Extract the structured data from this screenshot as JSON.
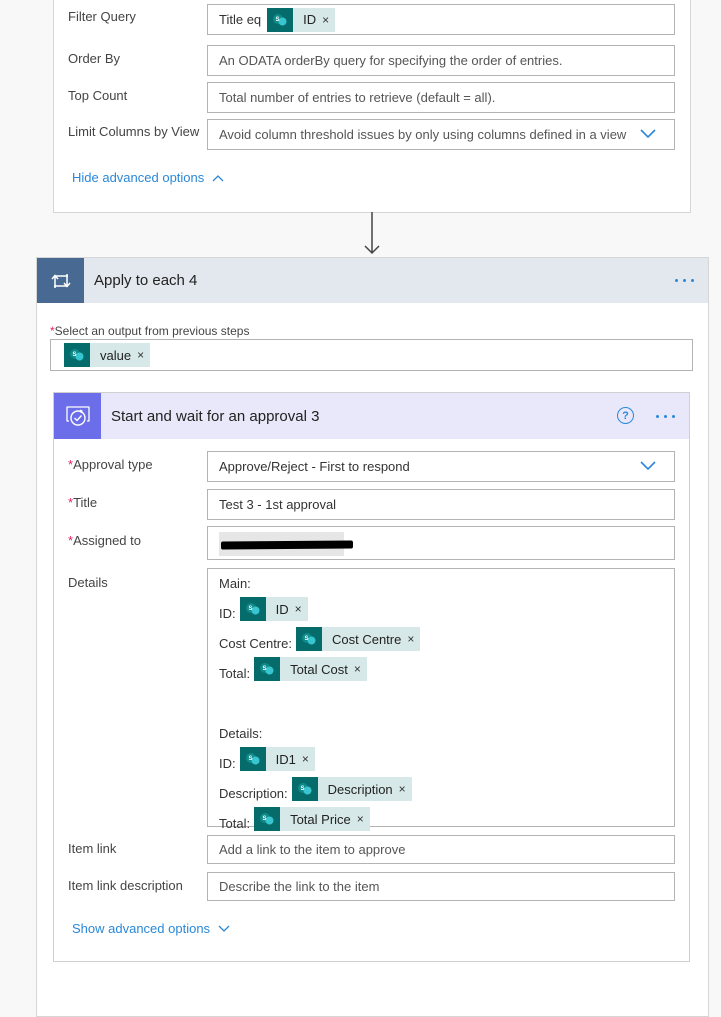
{
  "get_items_card": {
    "fields": [
      {
        "label": "Filter Query",
        "prefix_text": "Title eq",
        "token": {
          "icon": "sharepoint-icon",
          "label": "ID",
          "remove": "×"
        }
      },
      {
        "label": "Order By",
        "placeholder": "An ODATA orderBy query for specifying the order of entries."
      },
      {
        "label": "Top Count",
        "placeholder": "Total number of entries to retrieve (default = all)."
      },
      {
        "label": "Limit Columns by View",
        "placeholder": "Avoid column threshold issues by only using columns defined in a view",
        "dropdown_icon": "chevron-down-icon"
      }
    ],
    "advanced_link": "Hide advanced options"
  },
  "apply_to_each": {
    "title": "Apply to each 4",
    "icon": "loop-icon",
    "menu_icon": "more-options-icon",
    "required_marker": "*",
    "select_label": "Select an output from previous steps",
    "select_token": {
      "icon": "sharepoint-icon",
      "label": "value",
      "remove": "×"
    }
  },
  "approval": {
    "title": "Start and wait for an approval 3",
    "icon": "approval-icon",
    "help_glyph": "?",
    "required_marker": "*",
    "approval_type": {
      "label": "Approval type",
      "value": "Approve/Reject - First to respond"
    },
    "title_field": {
      "label": "Title",
      "value": "Test 3 - 1st approval"
    },
    "assigned_to": {
      "label": "Assigned to",
      "value": "[redacted]"
    },
    "details": {
      "label": "Details",
      "lines": [
        {
          "text": "Main:"
        },
        {
          "text": "ID:",
          "token": "ID"
        },
        {
          "text": "Cost Centre:",
          "token": "Cost Centre"
        },
        {
          "text": "Total:",
          "token": "Total Cost"
        },
        {
          "text": ""
        },
        {
          "text": "Details:"
        },
        {
          "text": "ID:",
          "token": "ID1"
        },
        {
          "text": "Description:",
          "token": "Description"
        },
        {
          "text": "Total:",
          "token": "Total Price"
        }
      ],
      "remove_glyph": "×"
    },
    "item_link": {
      "label": "Item link",
      "placeholder": "Add a link to the item to approve"
    },
    "item_link_description": {
      "label": "Item link description",
      "placeholder": "Describe the link to the item"
    },
    "advanced_link": "Show advanced options"
  },
  "colors": {
    "accent_blue": "#2b88d8",
    "loop_header": "#486991",
    "approval_header": "#6b6ee8",
    "sharepoint_token": "#056b6b",
    "required_red": "#e0245e"
  }
}
